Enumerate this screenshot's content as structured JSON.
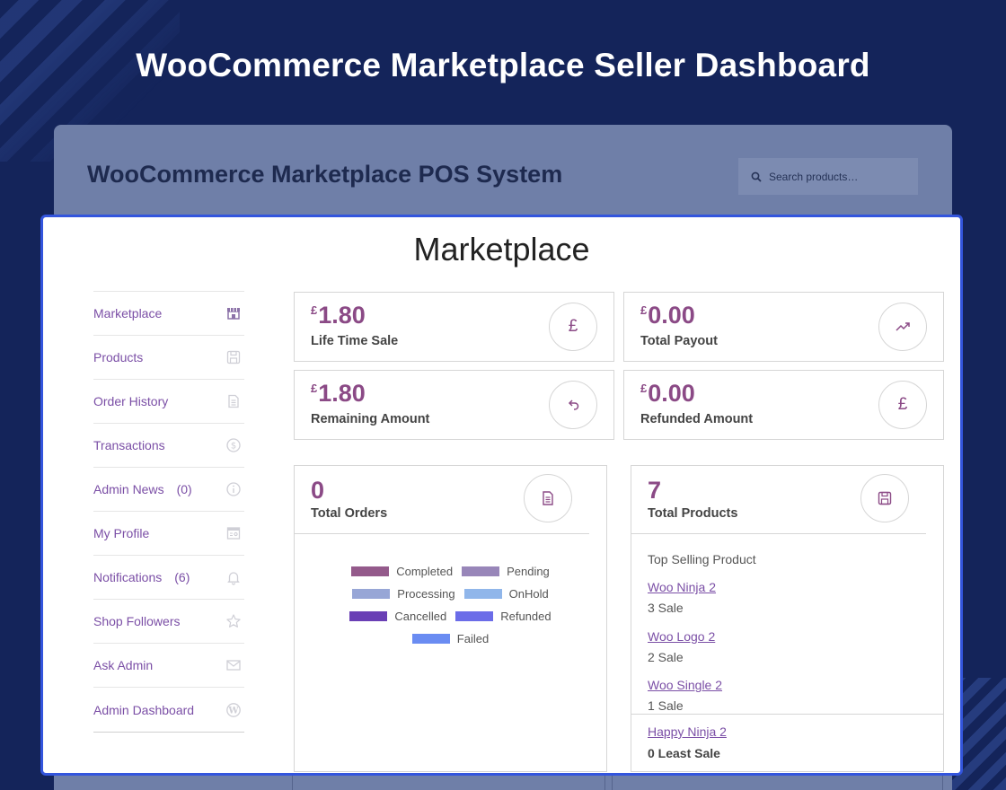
{
  "banner": {
    "title": "WooCommerce Marketplace Seller Dashboard"
  },
  "pos": {
    "title": "WooCommerce Marketplace POS System",
    "search_placeholder": "Search products…"
  },
  "card": {
    "title": "Marketplace"
  },
  "sidebar": {
    "items": [
      {
        "label": "Marketplace",
        "count": "",
        "icon": "store-icon"
      },
      {
        "label": "Products",
        "count": "",
        "icon": "save-icon"
      },
      {
        "label": "Order History",
        "count": "",
        "icon": "document-icon"
      },
      {
        "label": "Transactions",
        "count": "",
        "icon": "dollar-icon"
      },
      {
        "label": "Admin News",
        "count": "(0)",
        "icon": "info-icon"
      },
      {
        "label": "My Profile",
        "count": "",
        "icon": "profile-icon"
      },
      {
        "label": "Notifications",
        "count": "(6)",
        "icon": "bell-icon"
      },
      {
        "label": "Shop Followers",
        "count": "",
        "icon": "star-icon"
      },
      {
        "label": "Ask Admin",
        "count": "",
        "icon": "mail-icon"
      },
      {
        "label": "Admin Dashboard",
        "count": "",
        "icon": "wordpress-icon"
      }
    ]
  },
  "stats": {
    "lifetime_sale": {
      "currency": "£",
      "value": "1.80",
      "label": "Life Time Sale",
      "icon": "pound-icon"
    },
    "total_payout": {
      "currency": "£",
      "value": "0.00",
      "label": "Total Payout",
      "icon": "trending-up-icon"
    },
    "remaining_amount": {
      "currency": "£",
      "value": "1.80",
      "label": "Remaining Amount",
      "icon": "undo-icon"
    },
    "refunded_amount": {
      "currency": "£",
      "value": "0.00",
      "label": "Refunded Amount",
      "icon": "pound-icon"
    }
  },
  "orders": {
    "value": "0",
    "label": "Total Orders",
    "icon": "document-icon",
    "legend": [
      {
        "label": "Completed",
        "color": "#945a8b"
      },
      {
        "label": "Pending",
        "color": "#9886b9"
      },
      {
        "label": "Processing",
        "color": "#97a6d6"
      },
      {
        "label": "OnHold",
        "color": "#90b6ea"
      },
      {
        "label": "Cancelled",
        "color": "#6a3fb5"
      },
      {
        "label": "Refunded",
        "color": "#6b6ce8"
      },
      {
        "label": "Failed",
        "color": "#6a8cf2"
      }
    ]
  },
  "products": {
    "value": "7",
    "label": "Total Products",
    "icon": "save-icon",
    "top_heading": "Top Selling Product",
    "top": [
      {
        "name": "Woo Ninja 2",
        "sales": "3 Sale"
      },
      {
        "name": "Woo Logo 2",
        "sales": "2 Sale"
      },
      {
        "name": "Woo Single 2",
        "sales": "1 Sale"
      }
    ],
    "least": {
      "name": "Happy Ninja 2",
      "sales": "0 Least Sale"
    }
  }
}
